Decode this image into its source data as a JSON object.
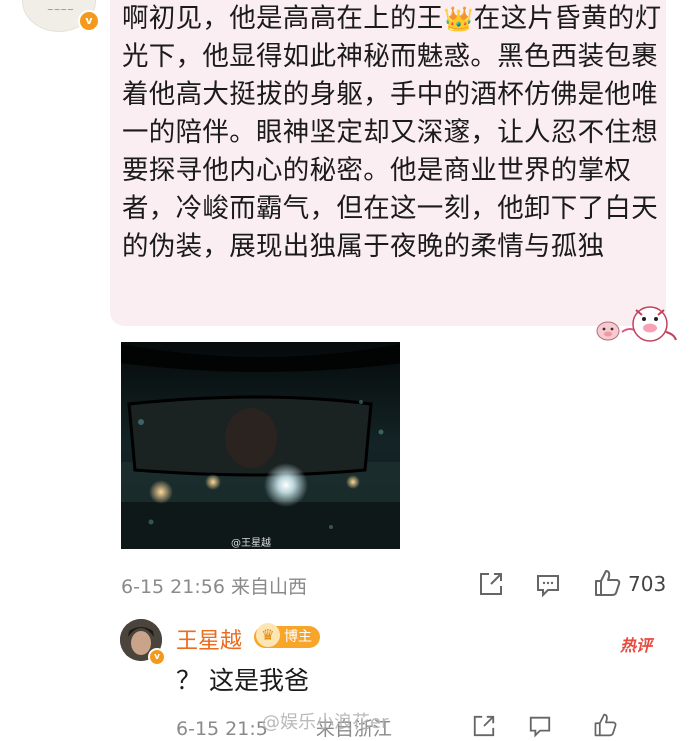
{
  "post": {
    "text": "啊初见，他是高高在上的王 在这片昏黄的灯光下，他显得如此神秘而魅惑。黑色西装包裹着他高大挺拔的身躯，手中的酒杯仿佛是他唯一的陪伴。眼神坚定却又深邃，让人忍不住想要探寻他内心的秘密。他是商业世界的掌权者，冷峻而霸气，但在这一刻，他卸下了白天的伪装，展现出独属于夜晚的柔情与孤独",
    "text_part1": "啊初见，他是高高在上的王",
    "crown_glyph": "👑",
    "text_part2": "在这片昏黄的灯光下，他显得如此神秘而魅惑。黑色西装包裹着他高大挺拔的身躯，手中的酒杯仿佛是他唯一的陪伴。眼神坚定却又深邃，让人忍不住想要探寻他内心的秘密。他是商业世界的掌权者，冷峻而霸气，但在这一刻，他卸下了白天的伪装，展现出独属于夜晚的柔情与孤独",
    "image_watermark": "@王星越",
    "meta": "6-15 21:56  来自山西",
    "like_count": "703",
    "bubble_color": "#fbeef3"
  },
  "reply": {
    "name": "王星越",
    "badge": "博主",
    "hot_tag": "热评",
    "text": "？ 这是我爸",
    "meta": "6-15 21:5",
    "meta_tail": "来自浙江",
    "name_color": "#ea6c1d"
  },
  "watermark": "@娱乐小浪花er",
  "icons": {
    "share": "share-icon",
    "comment": "comment-icon",
    "like": "thumbs-up-icon",
    "verified": "verified-v-icon"
  }
}
